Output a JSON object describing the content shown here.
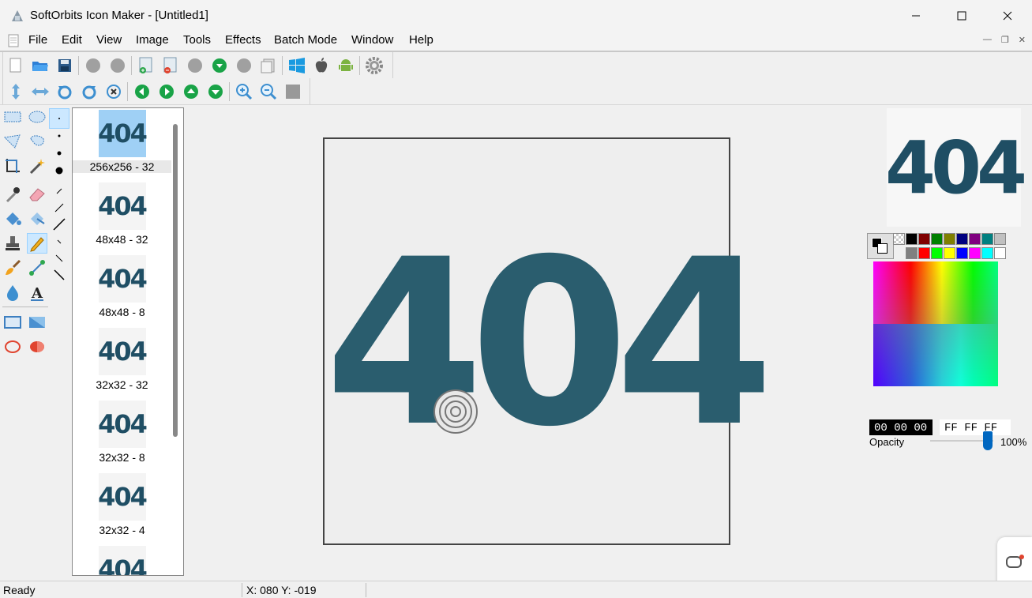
{
  "window": {
    "title": "SoftOrbits Icon Maker - [Untitled1]"
  },
  "menu": [
    "File",
    "Edit",
    "View",
    "Image",
    "Tools",
    "Effects",
    "Batch Mode",
    "Window",
    "Help"
  ],
  "icon_list": [
    {
      "label": "256x256 - 32",
      "selected": true
    },
    {
      "label": "48x48 - 32",
      "selected": false
    },
    {
      "label": "48x48 - 8",
      "selected": false
    },
    {
      "label": "32x32 - 32",
      "selected": false
    },
    {
      "label": "32x32 - 8",
      "selected": false
    },
    {
      "label": "32x32 - 4",
      "selected": false
    }
  ],
  "canvas": {
    "text": "404"
  },
  "preview": {
    "text": "404"
  },
  "thumb_text": "404",
  "palette_row1": [
    "#000000",
    "#800000",
    "#008000",
    "#808000",
    "#000080",
    "#800080",
    "#008080",
    "#c0c0c0"
  ],
  "palette_row2": [
    "#808080",
    "#ff0000",
    "#00ff00",
    "#ffff00",
    "#0000ff",
    "#ff00ff",
    "#00ffff",
    "#ffffff"
  ],
  "colors": {
    "primary_hex": "00 00 00",
    "secondary_hex": "FF FF FF"
  },
  "opacity": {
    "label": "Opacity",
    "value": "100%",
    "level": 1.0
  },
  "status": {
    "text": "Ready",
    "coords": "X: 080 Y: -019"
  }
}
